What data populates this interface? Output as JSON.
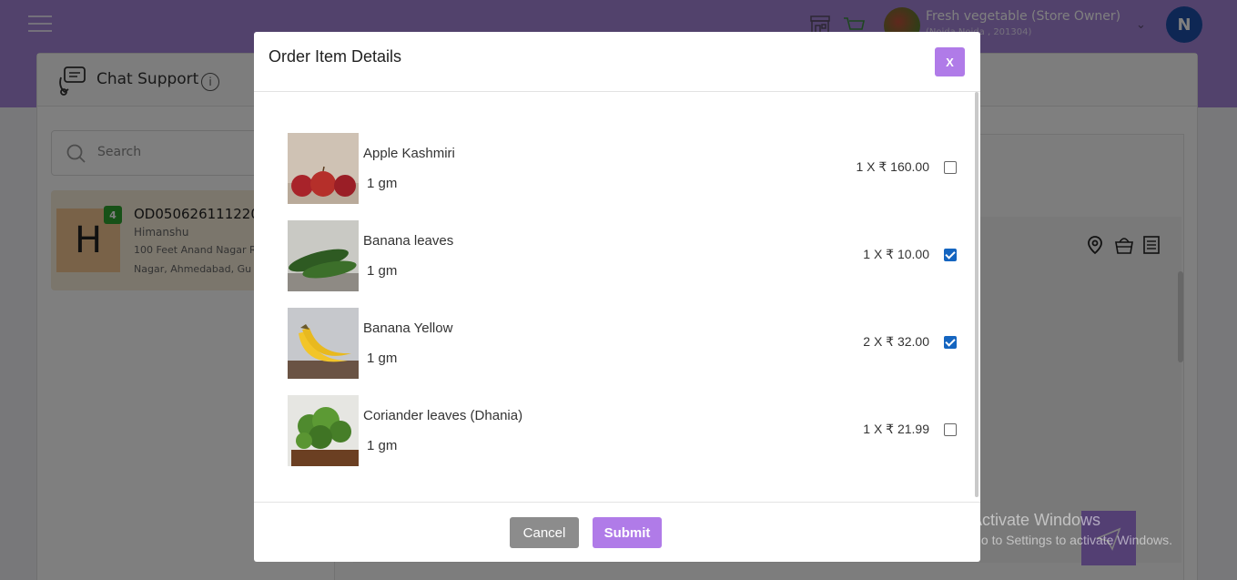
{
  "header": {
    "store_name": "Fresh vegetable (Store Owner)",
    "store_location": "(Noida Noida , 201304)",
    "user_initial": "N"
  },
  "chat_panel": {
    "title": "Chat Support",
    "info_glyph": "i",
    "search_placeholder": "Search",
    "card": {
      "letter": "H",
      "badge": "4",
      "order_id": "OD050626111220",
      "customer": "Himanshu",
      "address_line1": "100 Feet Anand Nagar R",
      "address_line2": "Nagar, Ahmedabad, Gu"
    }
  },
  "modal": {
    "title": "Order Item Details",
    "close_label": "X",
    "items": [
      {
        "name": "Apple Kashmiri",
        "unit": "1 gm",
        "price": "1 X ₹ 160.00",
        "checked": false,
        "image": "apple-photo"
      },
      {
        "name": "Banana leaves",
        "unit": "1 gm",
        "price": "1 X ₹ 10.00",
        "checked": true,
        "image": "banana-leaf-photo"
      },
      {
        "name": "Banana Yellow",
        "unit": "1 gm",
        "price": "2 X ₹ 32.00",
        "checked": true,
        "image": "banana-photo"
      },
      {
        "name": "Coriander leaves (Dhania)",
        "unit": "1 gm",
        "price": "1 X ₹ 21.99",
        "checked": false,
        "image": "coriander-photo"
      }
    ],
    "cancel_label": "Cancel",
    "submit_label": "Submit"
  },
  "watermark": {
    "line1": "Activate Windows",
    "line2": "Go to Settings to activate Windows."
  },
  "colors": {
    "topbar": "#a585d8",
    "accent": "#b07be8",
    "checkbox_checked": "#1565c0",
    "cancel": "#8c8c8c",
    "badge": "#2fa32f",
    "avatar": "#1d4fa8"
  }
}
